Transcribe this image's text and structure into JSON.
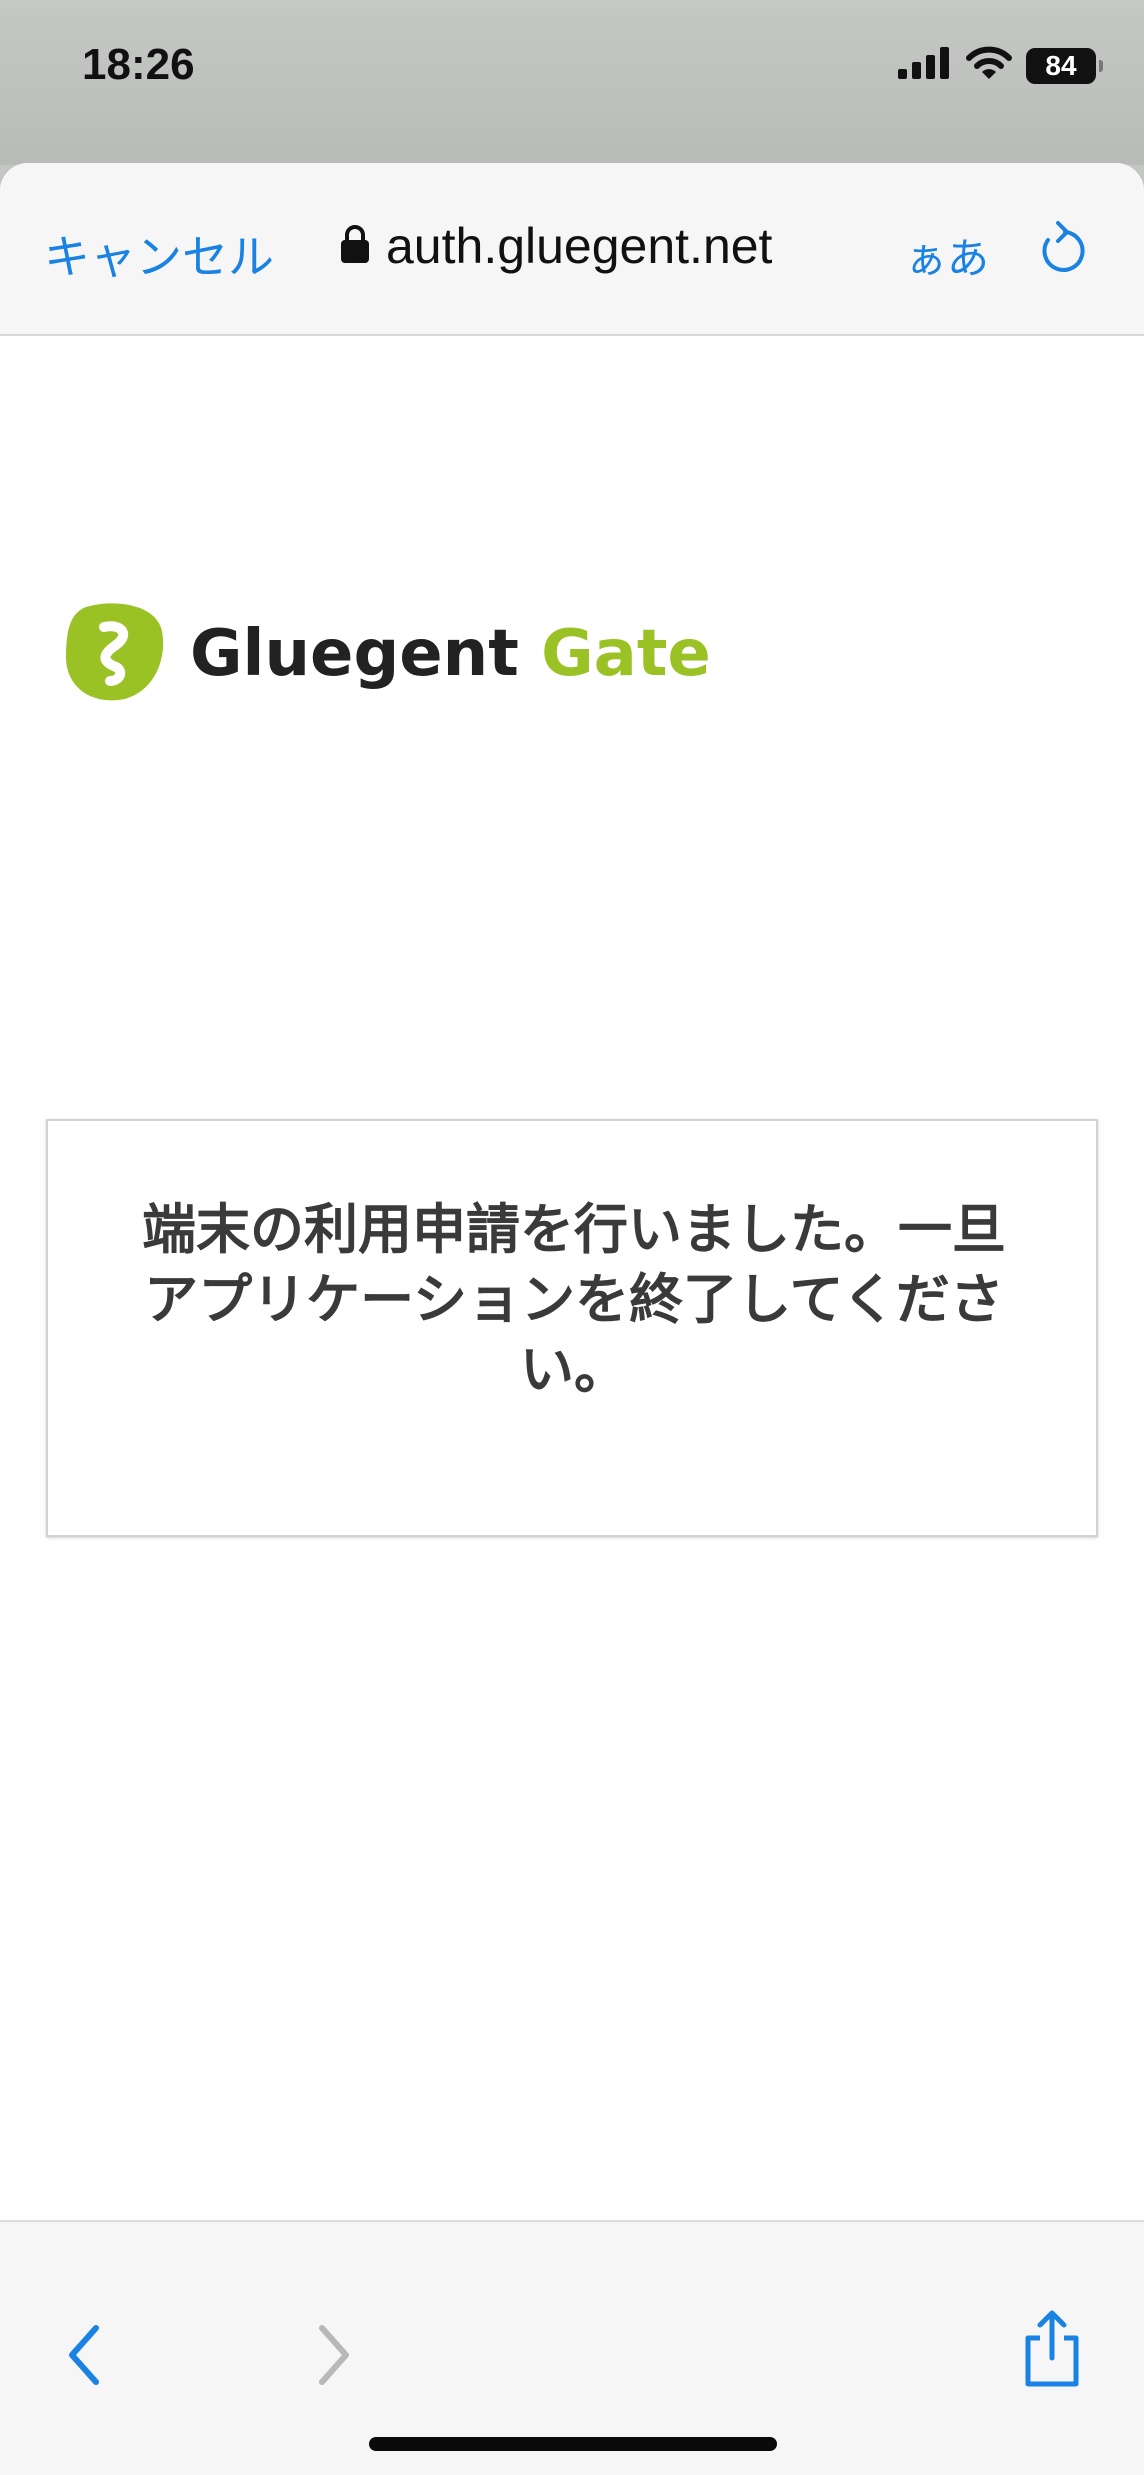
{
  "status_bar": {
    "time": "18:26",
    "battery": "84",
    "icons": [
      "cellular-signal-icon",
      "wifi-icon",
      "battery-icon"
    ]
  },
  "browser": {
    "cancel_label": "キャンセル",
    "url": "auth.gluegent.net",
    "text_size_label": "ぁあ",
    "icons": [
      "lock-icon",
      "reload-icon"
    ],
    "accent_color": "#1a82e2"
  },
  "page": {
    "logo": {
      "word1": "Gluegent",
      "word2": "Gate",
      "brand_color": "#9bc224"
    },
    "message": "端末の利用申請を行いました。一旦アプリケーションを終了してください。"
  },
  "toolbar": {
    "icons": [
      "back-icon",
      "forward-icon",
      "share-icon"
    ]
  }
}
